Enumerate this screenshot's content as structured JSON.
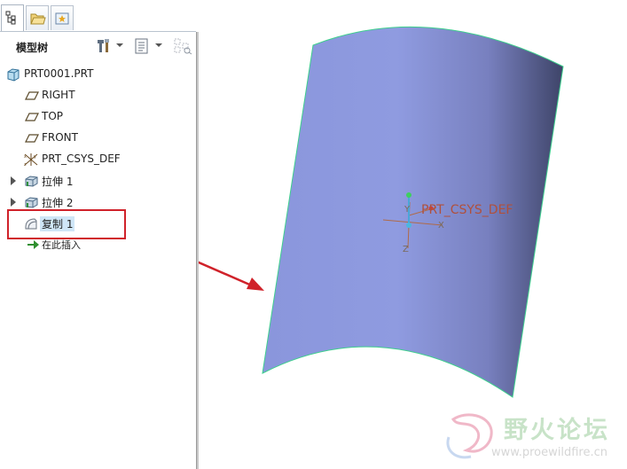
{
  "model_tree": {
    "title": "模型树",
    "items": [
      {
        "label": "PRT0001.PRT",
        "icon": "part-icon"
      },
      {
        "label": "RIGHT",
        "icon": "datum-plane-icon"
      },
      {
        "label": "TOP",
        "icon": "datum-plane-icon"
      },
      {
        "label": "FRONT",
        "icon": "datum-plane-icon"
      },
      {
        "label": "PRT_CSYS_DEF",
        "icon": "coordinate-system-icon"
      },
      {
        "label": "拉伸 1",
        "icon": "extrude-icon",
        "expandable": true
      },
      {
        "label": "拉伸 2",
        "icon": "extrude-icon",
        "expandable": true
      },
      {
        "label": "复制 1",
        "icon": "copy-surface-icon",
        "selected": true
      },
      {
        "label": "在此插入",
        "icon": "insert-here-arrow-icon"
      }
    ]
  },
  "tabs": [
    {
      "icon": "model-tree-tab-icon",
      "active": true
    },
    {
      "icon": "folder-browser-tab-icon",
      "active": false
    },
    {
      "icon": "favorites-tab-icon",
      "active": false
    }
  ],
  "toolbar": {
    "icons": [
      "tools-icon",
      "settings-list-icon",
      "filter-icon"
    ]
  },
  "viewport": {
    "csys_label": "PRT_CSYS_DEF",
    "axis_x": "X",
    "axis_y": "Y",
    "axis_z": "Z",
    "surface_color": "#8d99dc",
    "edge_color": "#3ecf8e",
    "annotation_color": "#d0222a"
  },
  "watermark": {
    "text": "野火论坛",
    "url": "www.proewildfire.cn"
  }
}
